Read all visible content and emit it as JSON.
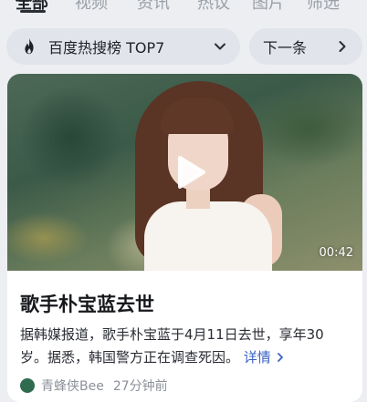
{
  "tabs": [
    {
      "label": "全部",
      "active": true
    },
    {
      "label": "视频",
      "active": false
    },
    {
      "label": "资讯",
      "active": false
    },
    {
      "label": "热议",
      "active": false
    },
    {
      "label": "图片",
      "active": false
    },
    {
      "label": "筛选",
      "active": false
    }
  ],
  "chips": {
    "hot_label": "百度热搜榜 TOP7",
    "next_label": "下一条"
  },
  "card": {
    "duration": "00:42",
    "title": "歌手朴宝蓝去世",
    "body": "据韩媒报道，歌手朴宝蓝于4月11日去世，享年30岁。据悉，韩国警方正在调查死因。",
    "more_label": "详情",
    "source_name": "青蜂侠Bee",
    "time_ago": "27分钟前"
  },
  "colors": {
    "accent_link": "#3a62c6",
    "page_bg": "#eceef1",
    "card_bg": "#ffffff"
  }
}
